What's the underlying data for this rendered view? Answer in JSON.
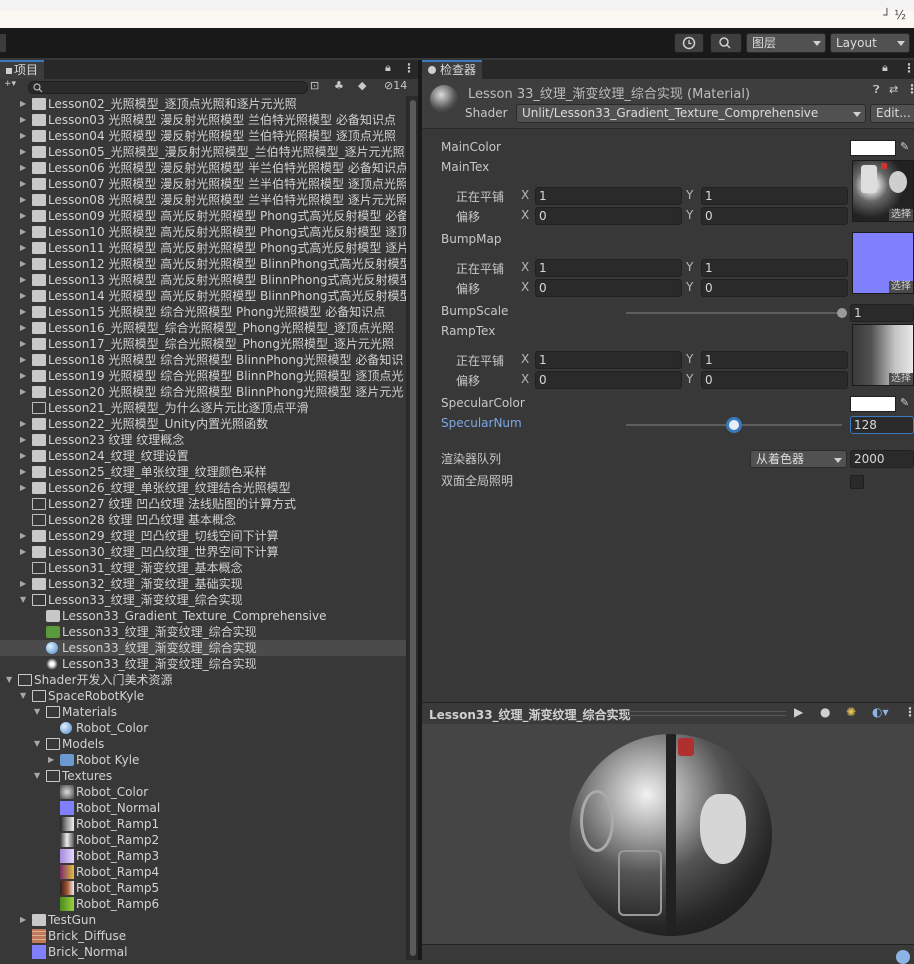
{
  "toolbar": {
    "corner_text": "┘  ½",
    "layers_label": "图层",
    "layout_label": "Layout"
  },
  "project": {
    "tab_label": "项目",
    "hidden_count": "14",
    "tree": [
      {
        "label": "Lesson02_光照模型_逐顶点光照和逐片元光照",
        "depth": 0,
        "type": "folder",
        "arrow": "closed"
      },
      {
        "label": "Lesson03 光照模型 漫反射光照模型 兰伯特光照模型 必备知识点",
        "depth": 0,
        "type": "folder",
        "arrow": "closed"
      },
      {
        "label": "Lesson04 光照模型 漫反射光照模型 兰伯特光照模型 逐顶点光照",
        "depth": 0,
        "type": "folder",
        "arrow": "closed"
      },
      {
        "label": "Lesson05_光照模型_漫反射光照模型_兰伯特光照模型_逐片元光照",
        "depth": 0,
        "type": "folder",
        "arrow": "closed"
      },
      {
        "label": "Lesson06 光照模型 漫反射光照模型 半兰伯特光照模型 必备知识点",
        "depth": 0,
        "type": "folder",
        "arrow": "closed"
      },
      {
        "label": "Lesson07 光照模型 漫反射光照模型 兰半伯特光照模型 逐顶点光照",
        "depth": 0,
        "type": "folder",
        "arrow": "closed"
      },
      {
        "label": "Lesson08 光照模型 漫反射光照模型 兰半伯特光照模型 逐片元光照",
        "depth": 0,
        "type": "folder",
        "arrow": "closed"
      },
      {
        "label": "Lesson09 光照模型 高光反射光照模型 Phong式高光反射模型 必备",
        "depth": 0,
        "type": "folder",
        "arrow": "closed"
      },
      {
        "label": "Lesson10 光照模型 高光反射光照模型 Phong式高光反射模型 逐顶",
        "depth": 0,
        "type": "folder",
        "arrow": "closed"
      },
      {
        "label": "Lesson11 光照模型 高光反射光照模型 Phong式高光反射模型 逐片",
        "depth": 0,
        "type": "folder",
        "arrow": "closed"
      },
      {
        "label": "Lesson12 光照模型 高光反射光照模型 BlinnPhong式高光反射模型",
        "depth": 0,
        "type": "folder",
        "arrow": "closed"
      },
      {
        "label": "Lesson13 光照模型 高光反射光照模型 BlinnPhong式高光反射模型",
        "depth": 0,
        "type": "folder",
        "arrow": "closed"
      },
      {
        "label": "Lesson14 光照模型 高光反射光照模型 BlinnPhong式高光反射模型",
        "depth": 0,
        "type": "folder",
        "arrow": "closed"
      },
      {
        "label": "Lesson15 光照模型 综合光照模型 Phong光照模型 必备知识点",
        "depth": 0,
        "type": "folder",
        "arrow": "closed"
      },
      {
        "label": "Lesson16_光照模型_综合光照模型_Phong光照模型_逐顶点光照",
        "depth": 0,
        "type": "folder",
        "arrow": "closed"
      },
      {
        "label": "Lesson17_光照模型_综合光照模型_Phong光照模型_逐片元光照",
        "depth": 0,
        "type": "folder",
        "arrow": "closed"
      },
      {
        "label": "Lesson18 光照模型 综合光照模型 BlinnPhong光照模型 必备知识",
        "depth": 0,
        "type": "folder",
        "arrow": "closed"
      },
      {
        "label": "Lesson19 光照模型 综合光照模型 BlinnPhong光照模型 逐顶点光",
        "depth": 0,
        "type": "folder",
        "arrow": "closed"
      },
      {
        "label": "Lesson20 光照模型 综合光照模型 BlinnPhong光照模型 逐片元光",
        "depth": 0,
        "type": "folder",
        "arrow": "closed"
      },
      {
        "label": "Lesson21_光照模型_为什么逐片元比逐顶点平滑",
        "depth": 0,
        "type": "empty-folder",
        "arrow": "none"
      },
      {
        "label": "Lesson22_光照模型_Unity内置光照函数",
        "depth": 0,
        "type": "folder",
        "arrow": "closed"
      },
      {
        "label": "Lesson23 纹理 纹理概念",
        "depth": 0,
        "type": "folder",
        "arrow": "closed"
      },
      {
        "label": "Lesson24_纹理_纹理设置",
        "depth": 0,
        "type": "folder",
        "arrow": "closed"
      },
      {
        "label": "Lesson25_纹理_单张纹理_纹理颜色采样",
        "depth": 0,
        "type": "folder",
        "arrow": "closed"
      },
      {
        "label": "Lesson26_纹理_单张纹理_纹理结合光照模型",
        "depth": 0,
        "type": "folder",
        "arrow": "closed"
      },
      {
        "label": "Lesson27 纹理 凹凸纹理 法线贴图的计算方式",
        "depth": 0,
        "type": "empty-folder",
        "arrow": "none"
      },
      {
        "label": "Lesson28 纹理 凹凸纹理 基本概念",
        "depth": 0,
        "type": "empty-folder",
        "arrow": "none"
      },
      {
        "label": "Lesson29_纹理_凹凸纹理_切线空间下计算",
        "depth": 0,
        "type": "folder",
        "arrow": "closed"
      },
      {
        "label": "Lesson30_纹理_凹凸纹理_世界空间下计算",
        "depth": 0,
        "type": "folder",
        "arrow": "closed"
      },
      {
        "label": "Lesson31_纹理_渐变纹理_基本概念",
        "depth": 0,
        "type": "empty-folder",
        "arrow": "none"
      },
      {
        "label": "Lesson32_纹理_渐变纹理_基础实现",
        "depth": 0,
        "type": "folder",
        "arrow": "closed"
      },
      {
        "label": "Lesson33_纹理_渐变纹理_综合实现",
        "depth": 0,
        "type": "open-folder",
        "arrow": "open"
      },
      {
        "label": "Lesson33_Gradient_Texture_Comprehensive",
        "depth": 1,
        "type": "shader",
        "arrow": "none"
      },
      {
        "label": "Lesson33_纹理_渐变纹理_综合实现",
        "depth": 1,
        "type": "script",
        "arrow": "none"
      },
      {
        "label": "Lesson33_纹理_渐变纹理_综合实现",
        "depth": 1,
        "type": "material",
        "arrow": "none",
        "selected": true
      },
      {
        "label": "Lesson33_纹理_渐变纹理_综合实现",
        "depth": 1,
        "type": "scene",
        "arrow": "none"
      },
      {
        "label": "Shader开发入门美术资源",
        "depth": -1,
        "type": "open-folder",
        "arrow": "open"
      },
      {
        "label": "SpaceRobotKyle",
        "depth": 0,
        "type": "open-folder",
        "arrow": "open"
      },
      {
        "label": "Materials",
        "depth": 1,
        "type": "open-folder",
        "arrow": "open"
      },
      {
        "label": "Robot_Color",
        "depth": 2,
        "type": "material",
        "arrow": "none"
      },
      {
        "label": "Models",
        "depth": 1,
        "type": "open-folder",
        "arrow": "open"
      },
      {
        "label": "Robot Kyle",
        "depth": 2,
        "type": "model",
        "arrow": "closed"
      },
      {
        "label": "Textures",
        "depth": 1,
        "type": "open-folder",
        "arrow": "open"
      },
      {
        "label": "Robot_Color",
        "depth": 2,
        "type": "tex-color",
        "arrow": "none"
      },
      {
        "label": "Robot_Normal",
        "depth": 2,
        "type": "tex-normal",
        "arrow": "none"
      },
      {
        "label": "Robot_Ramp1",
        "depth": 2,
        "type": "tex-ramp1",
        "arrow": "none"
      },
      {
        "label": "Robot_Ramp2",
        "depth": 2,
        "type": "tex-ramp2",
        "arrow": "none"
      },
      {
        "label": "Robot_Ramp3",
        "depth": 2,
        "type": "tex-ramp3",
        "arrow": "none"
      },
      {
        "label": "Robot_Ramp4",
        "depth": 2,
        "type": "tex-ramp4",
        "arrow": "none"
      },
      {
        "label": "Robot_Ramp5",
        "depth": 2,
        "type": "tex-ramp5",
        "arrow": "none"
      },
      {
        "label": "Robot_Ramp6",
        "depth": 2,
        "type": "tex-ramp6",
        "arrow": "none"
      },
      {
        "label": "TestGun",
        "depth": 0,
        "type": "folder",
        "arrow": "closed"
      },
      {
        "label": "Brick_Diffuse",
        "depth": 0,
        "type": "tex-brick",
        "arrow": "none"
      },
      {
        "label": "Brick_Normal",
        "depth": 0,
        "type": "tex-normal",
        "arrow": "none"
      }
    ]
  },
  "inspector": {
    "tab_label": "检查器",
    "title": "Lesson 33_纹理_渐变纹理_综合实现 (Material)",
    "shader_label": "Shader",
    "shader_value": "Unlit/Lesson33_Gradient_Texture_Comprehensive",
    "edit_label": "Edit...",
    "maincolor_label": "MainColor",
    "maintex_label": "MainTex",
    "tiling_label": "正在平铺",
    "offset_label": "偏移",
    "x_label": "X",
    "y_label": "Y",
    "maintex": {
      "tiling_x": "1",
      "tiling_y": "1",
      "offset_x": "0",
      "offset_y": "0"
    },
    "bumpmap_label": "BumpMap",
    "bumpmap": {
      "tiling_x": "1",
      "tiling_y": "1",
      "offset_x": "0",
      "offset_y": "0"
    },
    "bumpscale_label": "BumpScale",
    "bumpscale_value": "1",
    "bumpscale_fraction": 1.0,
    "ramptex_label": "RampTex",
    "ramptex": {
      "tiling_x": "1",
      "tiling_y": "1",
      "offset_x": "0",
      "offset_y": "0"
    },
    "select_label": "选择",
    "specularcolor_label": "SpecularColor",
    "specularnum_label": "SpecularNum",
    "specularnum_value": "128",
    "specularnum_fraction": 0.5,
    "renderqueue_label": "渲染器队列",
    "renderqueue_option": "从着色器",
    "renderqueue_value": "2000",
    "gi_label": "双面全局照明"
  },
  "preview": {
    "title": "Lesson33_纹理_渐变纹理_综合实现"
  },
  "colors": {
    "accent": "#3a79bb",
    "selected_row": "#4b4b4b",
    "normal_map": "#8080ff",
    "panel_bg": "#383838"
  }
}
